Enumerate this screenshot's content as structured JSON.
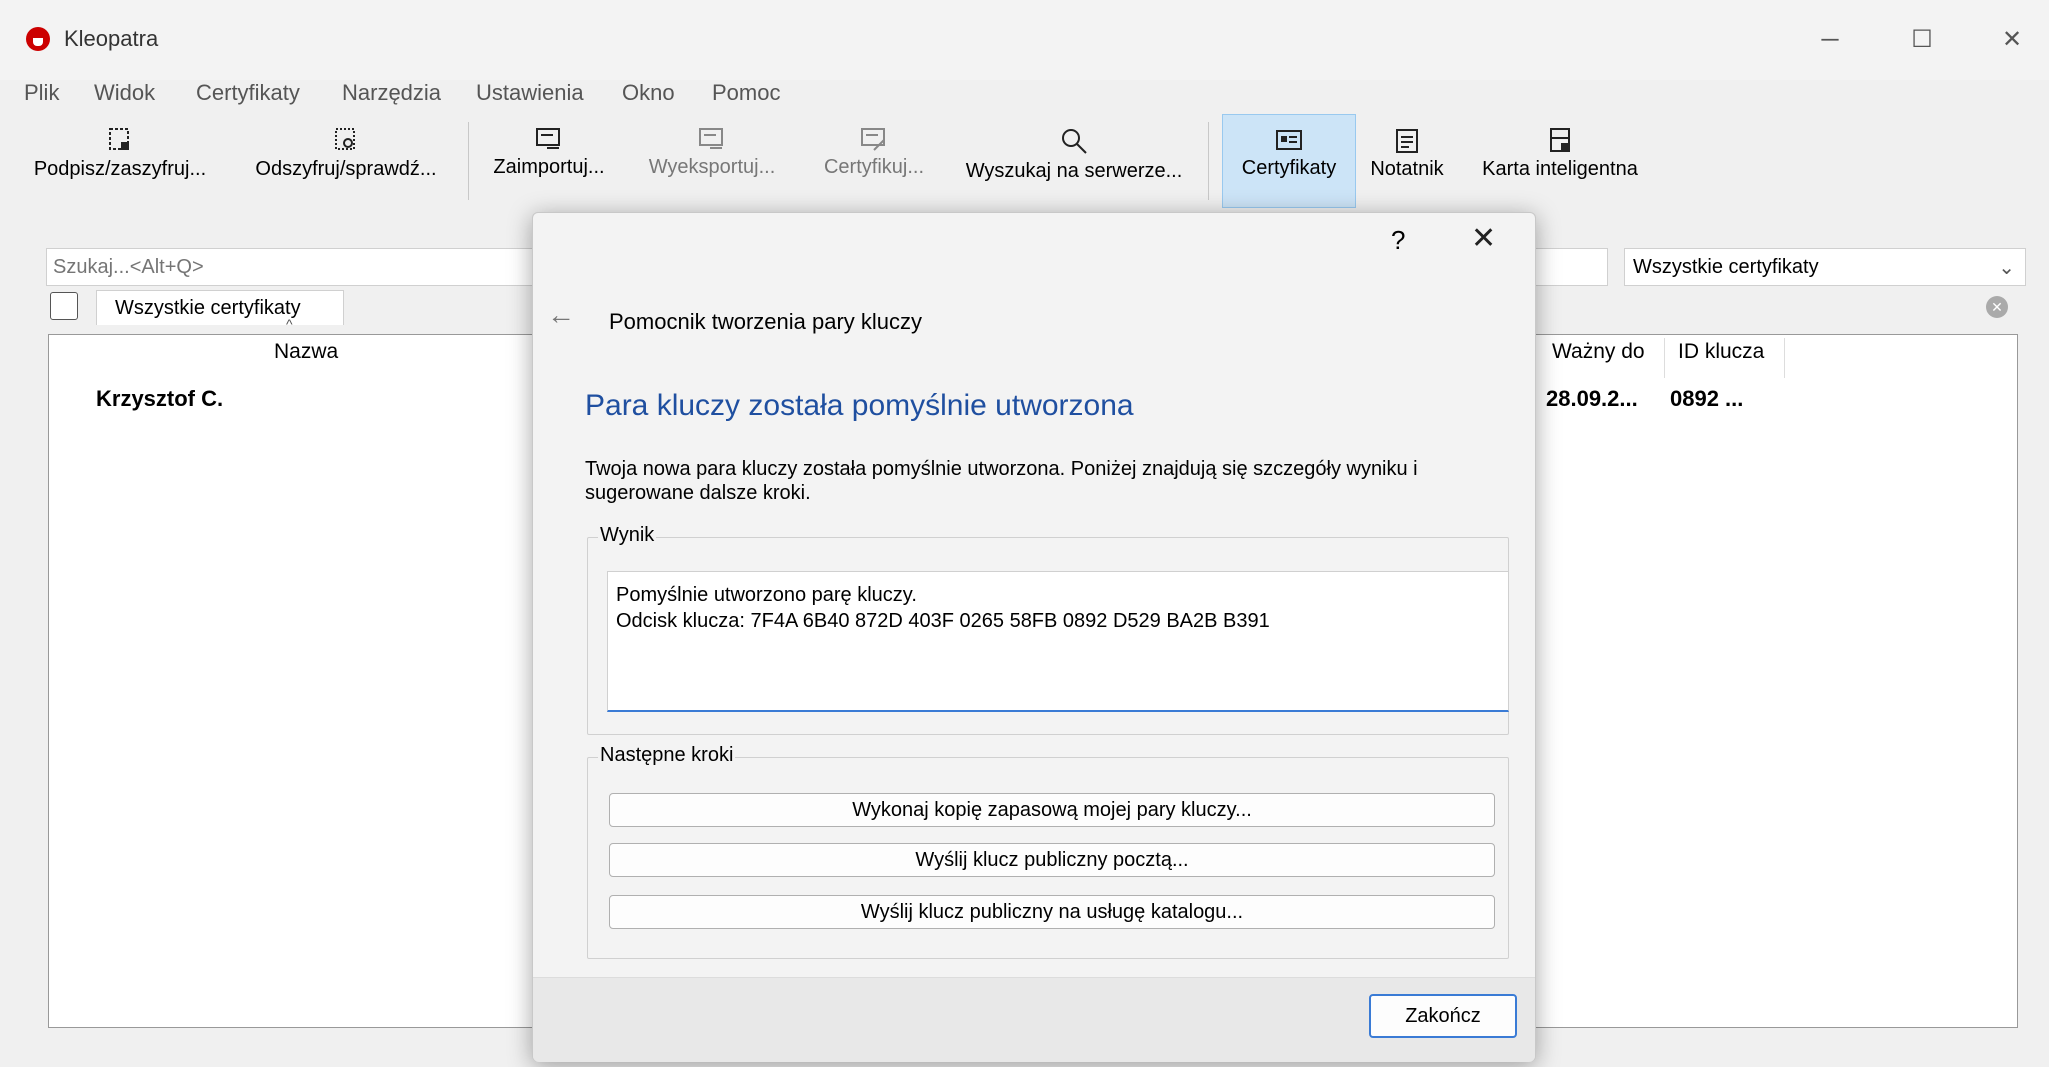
{
  "window": {
    "title": "Kleopatra"
  },
  "menu": [
    "Plik",
    "Widok",
    "Certyfikaty",
    "Narzędzia",
    "Ustawienia",
    "Okno",
    "Pomoc"
  ],
  "toolbar": {
    "sign": "Podpisz/zaszyfruj...",
    "decrypt": "Odszyfruj/sprawdź...",
    "import": "Zaimportuj...",
    "export": "Wyeksportuj...",
    "certify": "Certyfikuj...",
    "lookup": "Wyszukaj na serwerze...",
    "certificates": "Certyfikaty",
    "notepad": "Notatnik",
    "smartcard": "Karta inteligentna"
  },
  "search": {
    "placeholder": "Szukaj...<Alt+Q>"
  },
  "filter": {
    "selected": "Wszystkie certyfikaty"
  },
  "tab": {
    "label": "Wszystkie certyfikaty"
  },
  "table": {
    "columns": {
      "name": "Nazwa",
      "valid_until": "Ważny do",
      "key_id": "ID klucza"
    },
    "rows": [
      {
        "name": "Krzysztof C.",
        "valid_until": "28.09.2...",
        "key_id": "0892 ..."
      }
    ]
  },
  "dialog": {
    "help": "?",
    "close": "✕",
    "header": "Pomocnik tworzenia pary kluczy",
    "heading": "Para kluczy została pomyślnie utworzona",
    "description": "Twoja nowa para kluczy została pomyślnie utworzona. Poniżej znajdują się szczegóły wyniku i sugerowane dalsze kroki.",
    "result_title": "Wynik",
    "result_line1": "Pomyślnie utworzono parę kluczy.",
    "result_line2": "Odcisk klucza: 7F4A 6B40 872D 403F 0265  58FB 0892 D529 BA2B B391",
    "next_title": "Następne kroki",
    "step_backup": "Wykonaj kopię zapasową mojej pary kluczy...",
    "step_email": "Wyślij klucz publiczny pocztą...",
    "step_directory": "Wyślij klucz publiczny na usługę katalogu...",
    "finish": "Zakończ"
  },
  "colors": {
    "accent": "#3a7bd5",
    "heading": "#1f4fa0",
    "logo": "#cc0000",
    "active_tool": "#cce4f7"
  }
}
